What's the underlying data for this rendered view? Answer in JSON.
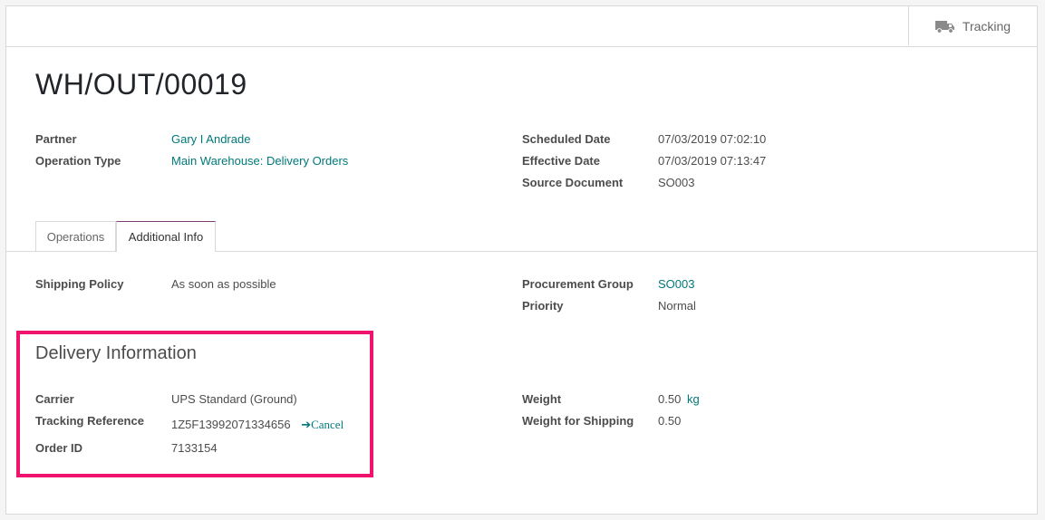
{
  "stat_button": {
    "label": "Tracking",
    "icon": "truck-icon"
  },
  "record": {
    "name": "WH/OUT/00019"
  },
  "fields_left": {
    "partner_label": "Partner",
    "partner_value": "Gary I Andrade",
    "operation_type_label": "Operation Type",
    "operation_type_value": "Main Warehouse: Delivery Orders"
  },
  "fields_right": {
    "scheduled_date_label": "Scheduled Date",
    "scheduled_date_value": "07/03/2019 07:02:10",
    "effective_date_label": "Effective Date",
    "effective_date_value": "07/03/2019 07:13:47",
    "source_document_label": "Source Document",
    "source_document_value": "SO003"
  },
  "tabs": [
    {
      "label": "Operations",
      "active": false
    },
    {
      "label": "Additional Info",
      "active": true
    }
  ],
  "additional_info": {
    "shipping_policy_label": "Shipping Policy",
    "shipping_policy_value": "As soon as possible",
    "procurement_group_label": "Procurement Group",
    "procurement_group_value": "SO003",
    "priority_label": "Priority",
    "priority_value": "Normal"
  },
  "delivery": {
    "title": "Delivery Information",
    "carrier_label": "Carrier",
    "carrier_value": "UPS Standard (Ground)",
    "tracking_label": "Tracking Reference",
    "tracking_value": "1Z5F13992071334656",
    "cancel_label": "Cancel",
    "order_id_label": "Order ID",
    "order_id_value": "7133154",
    "weight_label": "Weight",
    "weight_value": "0.50",
    "weight_unit": "kg",
    "weight_shipping_label": "Weight for Shipping",
    "weight_shipping_value": "0.50"
  },
  "colors": {
    "link": "#00787a",
    "highlight": "#f0136e",
    "tab_accent": "#7c3f73"
  }
}
